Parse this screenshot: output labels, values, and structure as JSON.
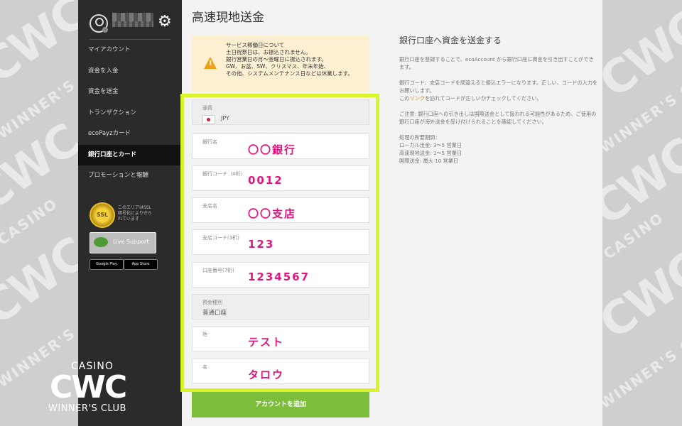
{
  "sidebar": {
    "items": [
      {
        "label": "マイアカウント",
        "active": false
      },
      {
        "label": "資金を入金",
        "active": false
      },
      {
        "label": "資金を送金",
        "active": false
      },
      {
        "label": "トランザクション",
        "active": false
      },
      {
        "label": "ecoPayzカード",
        "active": false
      },
      {
        "label": "銀行口座とカード",
        "active": true
      },
      {
        "label": "プロモーションと報酬",
        "active": false
      }
    ],
    "ssl_badge": "SSL",
    "ssl_text": "このエリアはSSL暗号化により守られています",
    "live_support": "Live Support",
    "google_play": "Google Play",
    "app_store": "App Store"
  },
  "watermark": {
    "casino": "CASINO",
    "brand": "CWC",
    "tagline": "WINNER'S CLUB"
  },
  "main": {
    "title": "高速現地送金",
    "notice": {
      "lines": [
        "サービス稼働日について",
        "土日祝祭日は、お振込されません。",
        "銀行営業日の月〜金曜日に振込されます。",
        "GW、お盆、SW、クリスマス、年末年始、",
        "その他、システムメンテナンス日などは休業します。"
      ]
    },
    "form": {
      "currency": {
        "label": "通貨",
        "value": "JPY"
      },
      "bank_name": {
        "label": "銀行名",
        "value": "〇〇銀行"
      },
      "bank_code": {
        "label": "銀行コード（4桁）",
        "value": "0012"
      },
      "branch_name": {
        "label": "支店名",
        "value": "〇〇支店"
      },
      "branch_code": {
        "label": "支店コード(3桁)",
        "value": "123"
      },
      "account_number": {
        "label": "口座番号(7桁)",
        "value": "1234567"
      },
      "account_type": {
        "label": "預金種別",
        "value": "普通口座"
      },
      "last_name": {
        "label": "姓",
        "value": "テスト"
      },
      "first_name": {
        "label": "名",
        "value": "タロウ"
      },
      "submit_label": "アカウントを追加"
    },
    "info": {
      "title": "銀行口座へ資金を送金する",
      "para1": "銀行口座を登録することで、ecoAccount から銀行口座に資金を引き出すことができます。",
      "para2a": "銀行コード、支店コードを間違えると振込エラーになります。正しい、コードの入力をお願いします。",
      "para2b_pre": "この",
      "para2b_link": "リンク",
      "para2b_post": "を訪れてコードが正しいかチェックしてください。",
      "para3": "ご注意: 銀行口座への引き出しは国際送金として扱われる可能性があるため、ご使用の銀行口座が海外送金を受け付けられることを確認してください。",
      "processing_title": "処理の所要期間：",
      "processing": [
        "ローカル出金: 3〜5 営業日",
        "高速現地送金: 1〜5 営業日",
        "国際送金: 最大 10 営業日"
      ]
    }
  },
  "colors": {
    "sidebar_bg": "#2b2b2b",
    "highlight_border": "#d8f32a",
    "value_pink": "#e0157d",
    "submit_green": "#7cbd3c",
    "notice_bg": "#fdf0d2",
    "warning_orange": "#f0a11c"
  }
}
